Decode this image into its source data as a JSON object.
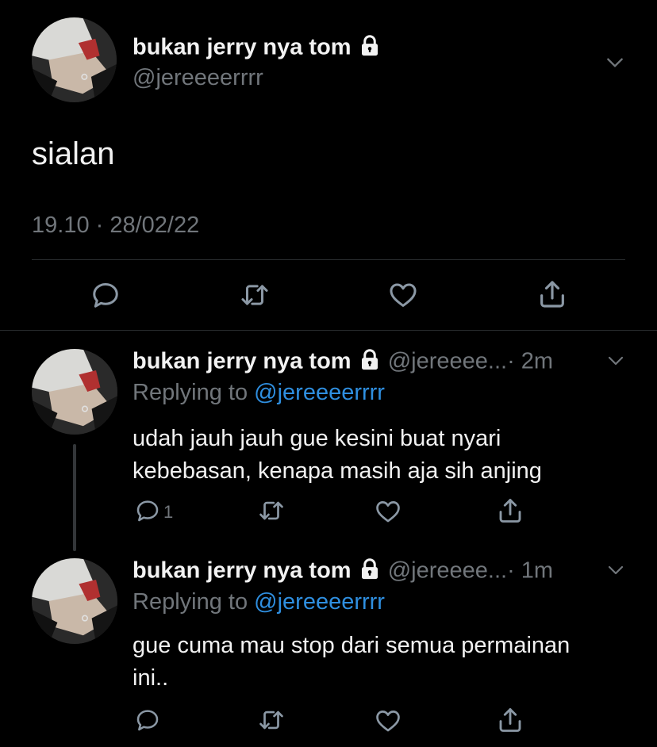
{
  "main_tweet": {
    "display_name": "bukan jerry nya tom",
    "handle": "@jereeeerrrr",
    "text": "sialan",
    "timestamp": "19.10 · 28/02/22"
  },
  "replies": [
    {
      "display_name": "bukan jerry nya tom",
      "handle_truncated": "@jereeee...",
      "time": "· 2m",
      "replying_label": "Replying to",
      "replying_handle": "@jereeeerrrr",
      "text_line1": "udah jauh jauh gue kesini buat nyari",
      "text_line2": "kebebasan, kenapa masih aja sih anjing",
      "reply_count": "1"
    },
    {
      "display_name": "bukan jerry nya tom",
      "handle_truncated": "@jereeee...",
      "time": "· 1m",
      "replying_label": "Replying to",
      "replying_handle": "@jereeeerrrr",
      "text_line1": "gue cuma mau stop dari semua permainan",
      "text_line2": "ini.."
    }
  ],
  "icons": {
    "lock": "lock-icon",
    "more": "chevron-down-icon",
    "reply": "reply-icon",
    "retweet": "retweet-icon",
    "like": "heart-icon",
    "share": "share-icon"
  },
  "colors": {
    "background": "#000000",
    "text": "#e7e9ea",
    "secondary": "#71767b",
    "link": "#2f8fe0"
  }
}
